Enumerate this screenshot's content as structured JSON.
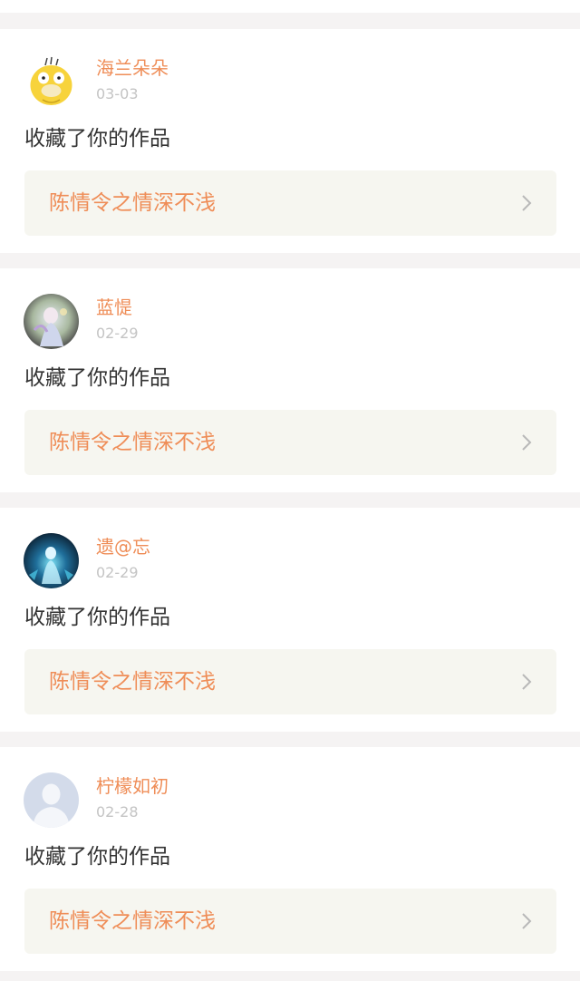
{
  "notifications": [
    {
      "user_name": "海兰朵朵",
      "date": "03-03",
      "action": "收藏了你的作品",
      "work_title": "陈情令之情深不浅",
      "avatar": "yellow-duck-avatar"
    },
    {
      "user_name": "蓝惿",
      "date": "02-29",
      "action": "收藏了你的作品",
      "work_title": "陈情令之情深不浅",
      "avatar": "pastel-character-avatar"
    },
    {
      "user_name": "遗@忘",
      "date": "02-29",
      "action": "收藏了你的作品",
      "work_title": "陈情令之情深不浅",
      "avatar": "blue-glow-character-avatar"
    },
    {
      "user_name": "柠檬如初",
      "date": "02-28",
      "action": "收藏了你的作品",
      "work_title": "陈情令之情深不浅",
      "avatar": "default-user-avatar"
    }
  ],
  "colors": {
    "accent": "#ef8d57",
    "date_gray": "#c4c4c4",
    "text_dark": "#333333",
    "link_bg": "#f6f6f0",
    "page_bg": "#f5f3f3"
  }
}
